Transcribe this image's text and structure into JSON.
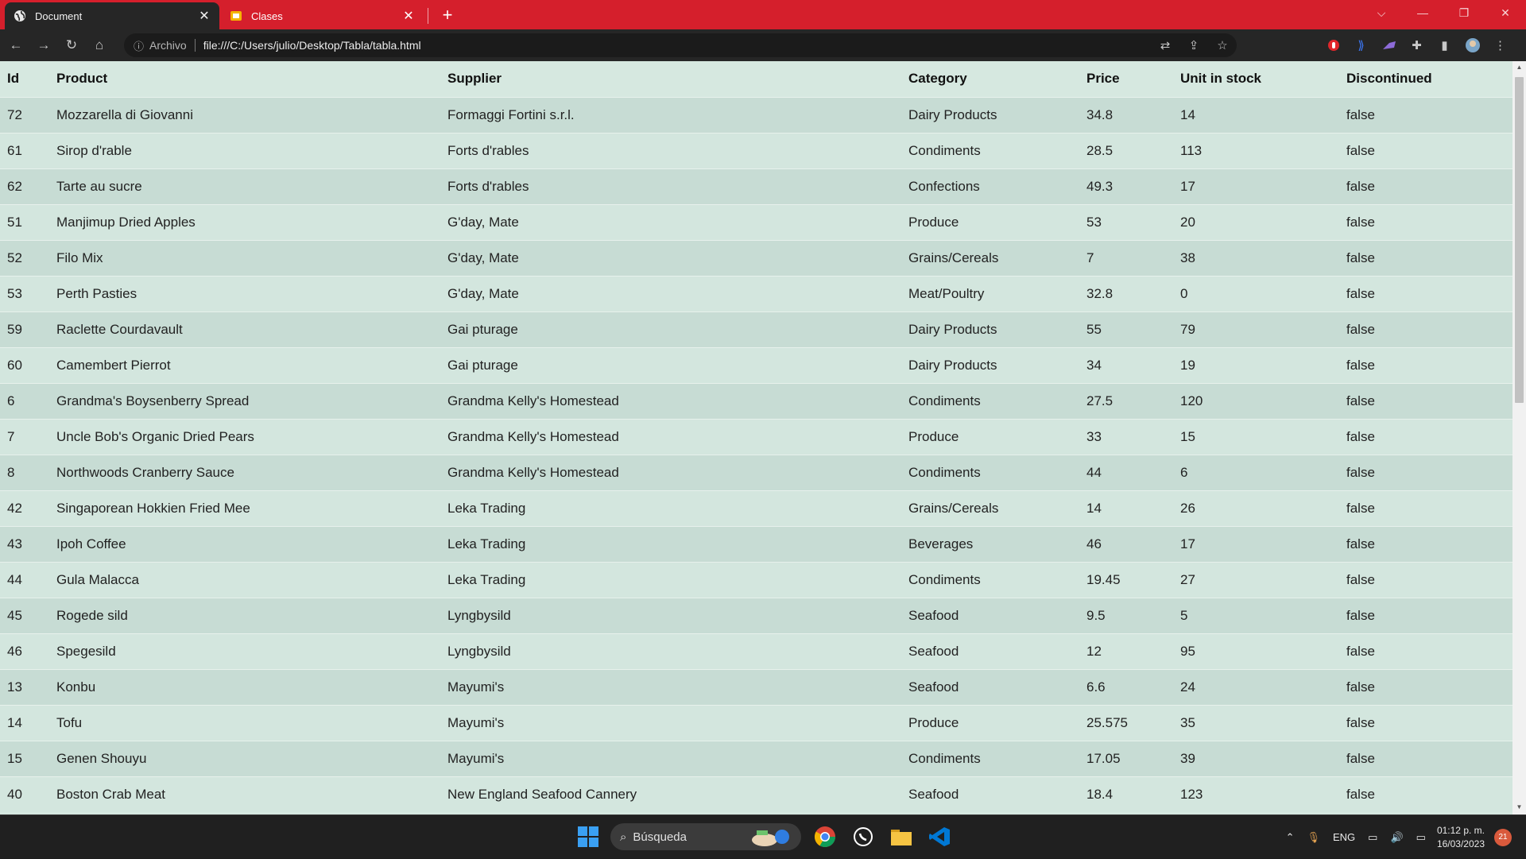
{
  "browser": {
    "tabs": [
      {
        "title": "Document",
        "icon": "globe-icon",
        "active": true
      },
      {
        "title": "Clases",
        "icon": "slides-icon",
        "active": false
      }
    ],
    "close_glyph": "✕",
    "new_tab_glyph": "+",
    "address": {
      "info_icon": "info-icon",
      "scheme_label": "Archivo",
      "url": "file:///C:/Users/julio/Desktop/Tabla/tabla.html"
    },
    "accent_color": "#d51f2c"
  },
  "table": {
    "columns": [
      "Id",
      "Product",
      "Supplier",
      "Category",
      "Price",
      "Unit in stock",
      "Discontinued"
    ],
    "rows": [
      [
        "72",
        "Mozzarella di Giovanni",
        "Formaggi Fortini s.r.l.",
        "Dairy Products",
        "34.8",
        "14",
        "false"
      ],
      [
        "61",
        "Sirop d'rable",
        "Forts d'rables",
        "Condiments",
        "28.5",
        "113",
        "false"
      ],
      [
        "62",
        "Tarte au sucre",
        "Forts d'rables",
        "Confections",
        "49.3",
        "17",
        "false"
      ],
      [
        "51",
        "Manjimup Dried Apples",
        "G'day, Mate",
        "Produce",
        "53",
        "20",
        "false"
      ],
      [
        "52",
        "Filo Mix",
        "G'day, Mate",
        "Grains/Cereals",
        "7",
        "38",
        "false"
      ],
      [
        "53",
        "Perth Pasties",
        "G'day, Mate",
        "Meat/Poultry",
        "32.8",
        "0",
        "false"
      ],
      [
        "59",
        "Raclette Courdavault",
        "Gai pturage",
        "Dairy Products",
        "55",
        "79",
        "false"
      ],
      [
        "60",
        "Camembert Pierrot",
        "Gai pturage",
        "Dairy Products",
        "34",
        "19",
        "false"
      ],
      [
        "6",
        "Grandma's Boysenberry Spread",
        "Grandma Kelly's Homestead",
        "Condiments",
        "27.5",
        "120",
        "false"
      ],
      [
        "7",
        "Uncle Bob's Organic Dried Pears",
        "Grandma Kelly's Homestead",
        "Produce",
        "33",
        "15",
        "false"
      ],
      [
        "8",
        "Northwoods Cranberry Sauce",
        "Grandma Kelly's Homestead",
        "Condiments",
        "44",
        "6",
        "false"
      ],
      [
        "42",
        "Singaporean Hokkien Fried Mee",
        "Leka Trading",
        "Grains/Cereals",
        "14",
        "26",
        "false"
      ],
      [
        "43",
        "Ipoh Coffee",
        "Leka Trading",
        "Beverages",
        "46",
        "17",
        "false"
      ],
      [
        "44",
        "Gula Malacca",
        "Leka Trading",
        "Condiments",
        "19.45",
        "27",
        "false"
      ],
      [
        "45",
        "Rogede sild",
        "Lyngbysild",
        "Seafood",
        "9.5",
        "5",
        "false"
      ],
      [
        "46",
        "Spegesild",
        "Lyngbysild",
        "Seafood",
        "12",
        "95",
        "false"
      ],
      [
        "13",
        "Konbu",
        "Mayumi's",
        "Seafood",
        "6.6",
        "24",
        "false"
      ],
      [
        "14",
        "Tofu",
        "Mayumi's",
        "Produce",
        "25.575",
        "35",
        "false"
      ],
      [
        "15",
        "Genen Shouyu",
        "Mayumi's",
        "Condiments",
        "17.05",
        "39",
        "false"
      ],
      [
        "40",
        "Boston Crab Meat",
        "New England Seafood Cannery",
        "Seafood",
        "18.4",
        "123",
        "false"
      ]
    ]
  },
  "taskbar": {
    "search_placeholder": "Búsqueda",
    "apps": [
      "chrome-icon",
      "whatsapp-icon",
      "file-explorer-icon",
      "vscode-icon"
    ],
    "language": "ENG",
    "time": "01:12 p. m.",
    "date": "16/03/2023",
    "notification_count": "21"
  }
}
